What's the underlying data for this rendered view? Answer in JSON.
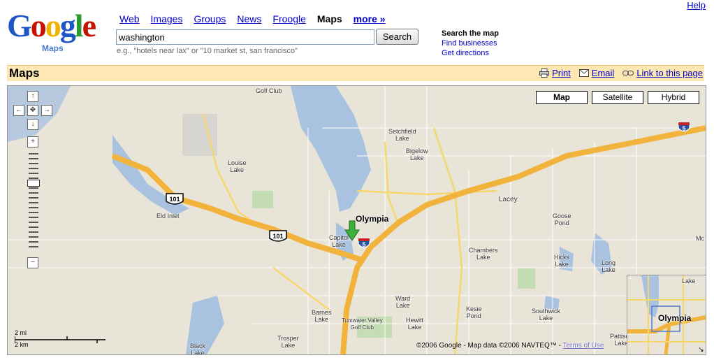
{
  "header": {
    "help": "Help",
    "logo_text": "Google",
    "logo_sub": "Maps",
    "tabs": [
      {
        "label": "Web"
      },
      {
        "label": "Images"
      },
      {
        "label": "Groups"
      },
      {
        "label": "News"
      },
      {
        "label": "Froogle"
      },
      {
        "label": "Maps"
      },
      {
        "label": "more »"
      }
    ],
    "search_value": "washington",
    "search_button": "Search",
    "hint": "e.g., \"hotels near lax\" or \"10 market st, san francisco\"",
    "side_heading": "Search the map",
    "find_businesses": "Find businesses",
    "get_directions": "Get directions"
  },
  "bar": {
    "title": "Maps",
    "print": "Print",
    "email": "Email",
    "link": "Link to this page"
  },
  "map": {
    "types": [
      "Map",
      "Satellite",
      "Hybrid"
    ],
    "selected_type": "Map",
    "scale_mi": "2 mi",
    "scale_km": "2 km",
    "copyright": "©2006 Google - Map data ©2006 NAVTEQ™ -",
    "terms": "Terms of Use",
    "main_city": "Olympia",
    "overview_city": "Olympia",
    "shields": {
      "us101a": "101",
      "us101b": "101",
      "i5a": "5",
      "i5b": "5"
    },
    "labels": {
      "golf_club": "Golf Club",
      "setchfield": "Setchfield\nLake",
      "bigelow": "Bigelow\nLake",
      "louise": "Louise\nLake",
      "eld": "Eld Inlet",
      "capitol": "Capitol\nLake",
      "lacey": "Lacey",
      "goose": "Goose\nPond",
      "chambers": "Chambers\nLake",
      "hicks": "Hicks\nLake",
      "long": "Long\nLake",
      "ward": "Ward\nLake",
      "kesie": "Kesie\nPond",
      "southwick": "Southwick\nLake",
      "pattison": "Pattison\nLake",
      "barnes": "Barnes\nLake",
      "tumwater": "Tumwater Valley\nGolf Club",
      "hewitt": "Hewitt\nLake",
      "trosper": "Trosper\nLake",
      "black": "Black\nLake",
      "mc": "Mc",
      "ov_lake": "Lake"
    }
  }
}
